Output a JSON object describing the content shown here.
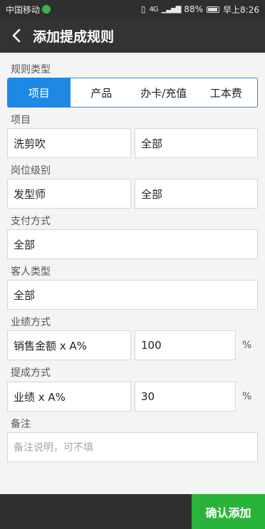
{
  "status_bar": {
    "carrier": "中国移动",
    "signal": "4G",
    "battery": "88%",
    "time": "早上8:26"
  },
  "header": {
    "title": "添加提成规则"
  },
  "form": {
    "rule_type": {
      "label": "规则类型",
      "options": [
        "项目",
        "产品",
        "办卡/充值",
        "工本费"
      ],
      "selected": "项目"
    },
    "item": {
      "label": "项目",
      "value1": "洗剪吹",
      "value2": "全部"
    },
    "position_level": {
      "label": "岗位级别",
      "value1": "发型师",
      "value2": "全部"
    },
    "payment_method": {
      "label": "支付方式",
      "value": "全部"
    },
    "customer_type": {
      "label": "客人类型",
      "value": "全部"
    },
    "performance_method": {
      "label": "业绩方式",
      "formula": "销售金额 x A%",
      "value": "100",
      "unit": "%"
    },
    "commission_method": {
      "label": "提成方式",
      "formula": "业绩 x A%",
      "value": "30",
      "unit": "%"
    },
    "remark": {
      "label": "备注",
      "placeholder": "备注说明，可不填"
    }
  },
  "footer": {
    "confirm_label": "确认添加"
  },
  "colors": {
    "accent": "#1e88e5",
    "confirm": "#2ab33a",
    "header_bg": "#333333"
  }
}
